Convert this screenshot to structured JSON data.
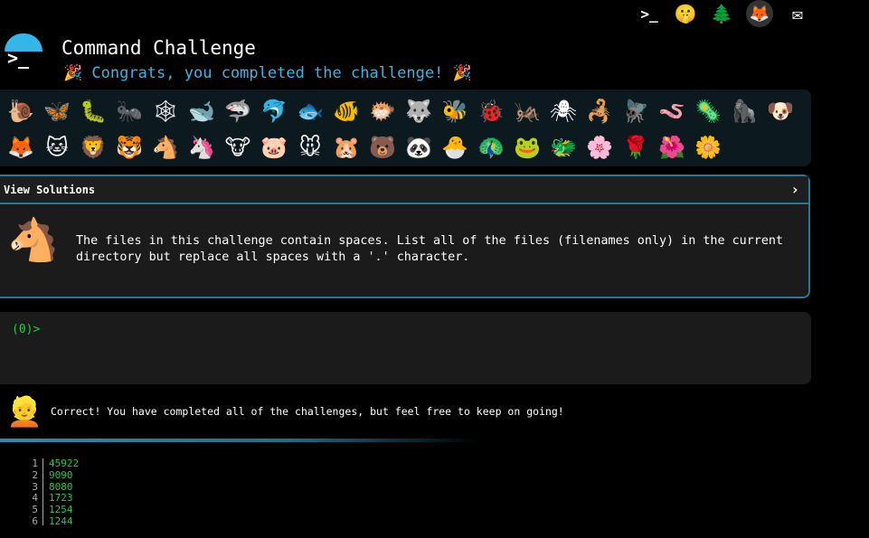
{
  "header": {
    "title": "Command Challenge",
    "subtitle": "🎉 Congrats, you completed the challenge! 🎉",
    "logo_prompt": ">_",
    "top_icons": [
      {
        "name": "terminal-icon",
        "glyph": ">_"
      },
      {
        "name": "shushing-face-icon",
        "glyph": "🤫"
      },
      {
        "name": "christmas-tree-icon",
        "glyph": "🌲"
      },
      {
        "name": "gitlab-icon",
        "glyph": "🦊"
      },
      {
        "name": "mail-icon",
        "glyph": "✉"
      }
    ]
  },
  "emojis": {
    "row1": [
      {
        "name": "snail-icon",
        "glyph": "🐌"
      },
      {
        "name": "butterfly-icon",
        "glyph": "🦋"
      },
      {
        "name": "caterpillar-icon",
        "glyph": "🐛"
      },
      {
        "name": "ant-icon",
        "glyph": "🐜"
      },
      {
        "name": "spider-web-icon",
        "glyph": "🕸"
      },
      {
        "name": "whale-icon",
        "glyph": "🐋"
      },
      {
        "name": "shark-icon",
        "glyph": "🦈"
      },
      {
        "name": "dolphin-icon",
        "glyph": "🐬"
      },
      {
        "name": "fish-icon",
        "glyph": "🐟"
      },
      {
        "name": "tropical-fish-icon",
        "glyph": "🐠"
      },
      {
        "name": "blowfish-icon",
        "glyph": "🐡"
      },
      {
        "name": "wolf-icon",
        "glyph": "🐺"
      },
      {
        "name": "bee-icon",
        "glyph": "🐝"
      },
      {
        "name": "ladybug-icon",
        "glyph": "🐞"
      },
      {
        "name": "cricket-icon",
        "glyph": "🦗"
      },
      {
        "name": "spider-icon",
        "glyph": "🕷"
      },
      {
        "name": "scorpion-icon",
        "glyph": "🦂"
      },
      {
        "name": "fly-icon",
        "glyph": "🪰"
      },
      {
        "name": "worm-icon",
        "glyph": "🪱"
      },
      {
        "name": "microbe-icon",
        "glyph": "🦠"
      },
      {
        "name": "gorilla-icon",
        "glyph": "🦍"
      },
      {
        "name": "dog-icon",
        "glyph": "🐶"
      }
    ],
    "row2": [
      {
        "name": "fox-icon",
        "glyph": "🦊"
      },
      {
        "name": "cat-icon",
        "glyph": "🐱"
      },
      {
        "name": "lion-icon",
        "glyph": "🦁"
      },
      {
        "name": "tiger-icon",
        "glyph": "🐯"
      },
      {
        "name": "horse-icon",
        "glyph": "🐴"
      },
      {
        "name": "unicorn-icon",
        "glyph": "🦄"
      },
      {
        "name": "cow-icon",
        "glyph": "🐮"
      },
      {
        "name": "pig-icon",
        "glyph": "🐷"
      },
      {
        "name": "mouse-icon",
        "glyph": "🐭"
      },
      {
        "name": "hamster-icon",
        "glyph": "🐹"
      },
      {
        "name": "bear-icon",
        "glyph": "🐻"
      },
      {
        "name": "panda-icon",
        "glyph": "🐼"
      },
      {
        "name": "hatching-chick-icon",
        "glyph": "🐣"
      },
      {
        "name": "peacock-icon",
        "glyph": "🦚"
      },
      {
        "name": "frog-icon",
        "glyph": "🐸"
      },
      {
        "name": "dragon-icon",
        "glyph": "🐲"
      },
      {
        "name": "cherry-blossom-icon",
        "glyph": "🌸"
      },
      {
        "name": "rose-icon",
        "glyph": "🌹"
      },
      {
        "name": "flower-icon",
        "glyph": "🌺"
      },
      {
        "name": "sunflower-icon",
        "glyph": "🌼"
      }
    ]
  },
  "solutions": {
    "label": "View Solutions",
    "chevron": "›",
    "challenge_icon": "🐴",
    "description": "The files in this challenge contain spaces. List all of the files (filenames only) in the current directory but replace all spaces with a '.' character."
  },
  "terminal": {
    "prompt": "(0)>"
  },
  "message": {
    "avatar": "👱",
    "text": "Correct! You have completed all of the challenges, but feel free to keep on going!"
  },
  "output": [
    {
      "num": "1",
      "value": "45922"
    },
    {
      "num": "2",
      "value": "9090"
    },
    {
      "num": "3",
      "value": "8080"
    },
    {
      "num": "4",
      "value": "1723"
    },
    {
      "num": "5",
      "value": "1254"
    },
    {
      "num": "6",
      "value": "1244"
    }
  ],
  "colors": {
    "accent": "#35b6e8",
    "border": "#267a95",
    "prompt_green": "#22c94a",
    "panel_bg": "#1b1b1b",
    "strip_bg": "#0c1a1f"
  }
}
